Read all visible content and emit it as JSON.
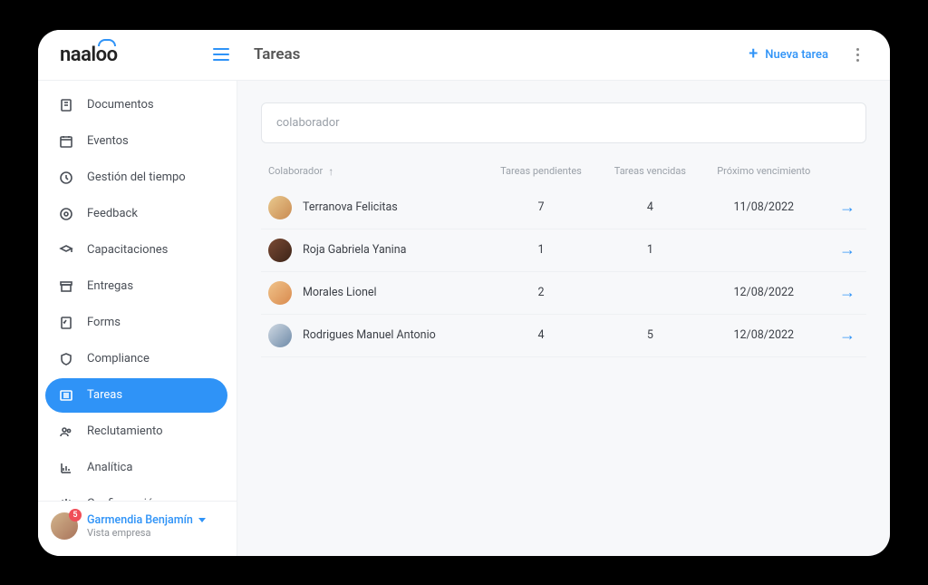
{
  "brand": "naaloo",
  "header": {
    "page_title": "Tareas",
    "new_task_label": "Nueva tarea"
  },
  "sidebar": {
    "items": [
      {
        "label": "Documentos",
        "icon": "document"
      },
      {
        "label": "Eventos",
        "icon": "calendar"
      },
      {
        "label": "Gestión del tiempo",
        "icon": "clock"
      },
      {
        "label": "Feedback",
        "icon": "target"
      },
      {
        "label": "Capacitaciones",
        "icon": "graduation"
      },
      {
        "label": "Entregas",
        "icon": "archive"
      },
      {
        "label": "Forms",
        "icon": "form"
      },
      {
        "label": "Compliance",
        "icon": "shield"
      },
      {
        "label": "Tareas",
        "icon": "list",
        "active": true
      },
      {
        "label": "Reclutamiento",
        "icon": "people"
      },
      {
        "label": "Analítica",
        "icon": "chart"
      },
      {
        "label": "Configuración",
        "icon": "gear"
      }
    ]
  },
  "user": {
    "name": "Garmendia Benjamín",
    "subtitle": "Vista empresa",
    "badge": "5"
  },
  "search": {
    "placeholder": "colaborador"
  },
  "table": {
    "columns": {
      "colaborador": "Colaborador",
      "pendientes": "Tareas pendientes",
      "vencidas": "Tareas vencidas",
      "proximo": "Próximo vencimiento"
    },
    "rows": [
      {
        "name": "Terranova Felicitas",
        "pendientes": "7",
        "vencidas": "4",
        "proximo": "11/08/2022",
        "avatar": "c1"
      },
      {
        "name": "Roja Gabriela Yanina",
        "pendientes": "1",
        "vencidas": "1",
        "proximo": "",
        "avatar": "c2"
      },
      {
        "name": "Morales Lionel",
        "pendientes": "2",
        "vencidas": "",
        "proximo": "12/08/2022",
        "avatar": "c3"
      },
      {
        "name": "Rodrigues Manuel Antonio",
        "pendientes": "4",
        "vencidas": "5",
        "proximo": "12/08/2022",
        "avatar": "c4"
      }
    ]
  }
}
